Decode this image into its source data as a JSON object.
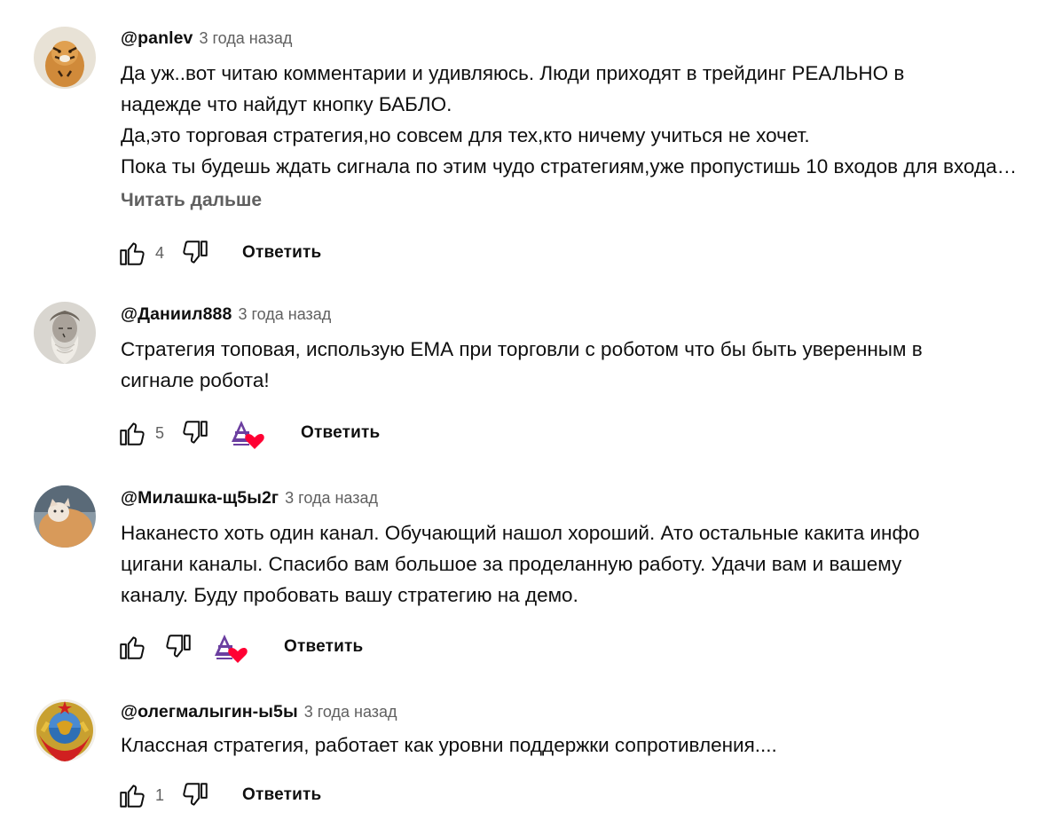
{
  "comments": [
    {
      "author": "@panlev",
      "time": "3 года назад",
      "lines": [
        "Да уж..вот читаю комментарии и удивляюсь. Люди приходят в трейдинг РЕАЛЬНО в",
        "надежде что найдут кнопку БАБЛО.",
        "Да,это торговая стратегия,но совсем для тех,кто ничему учиться не хочет.",
        "Пока ты будешь ждать сигнала по этим чудо стратегиям,уже пропустишь 10 входов для входа…"
      ],
      "read_more": "Читать дальше",
      "likes": "4",
      "reply": "Ответить",
      "avatar_icon": "tiger-avatar"
    },
    {
      "author": "@Даниил888",
      "time": "3 года назад",
      "lines": [
        "Стратегия топовая, использую ЕМА при торговли с роботом что бы быть уверенным в",
        "сигнале робота!"
      ],
      "likes": "5",
      "reply": "Ответить",
      "avatar_icon": "portrait-avatar",
      "creator_heart": true
    },
    {
      "author": "@Милашка-щ5ы2г",
      "time": "3 года назад",
      "lines": [
        "Наканесто хоть один канал. Обучающий нашол хороший. Ато остальные какита инфо",
        "цигани каналы. Спасибо вам большое за проделанную работу. Удачи вам и вашему",
        "каналу. Буду пробовать вашу стратегию на демо."
      ],
      "likes": "",
      "reply": "Ответить",
      "avatar_icon": "cat-avatar",
      "creator_heart": true
    },
    {
      "author": "@олегмалыгин-ы5ы",
      "time": "3 года назад",
      "lines": [
        "Классная стратегия, работает как уровни поддержки сопротивления...."
      ],
      "likes": "1",
      "reply": "Ответить",
      "avatar_icon": "emblem-avatar"
    }
  ],
  "colors": {
    "text": "#0f0f0f",
    "secondary": "#606060",
    "heart": "#ff0033",
    "channel_logo": "#6b3fa0"
  }
}
